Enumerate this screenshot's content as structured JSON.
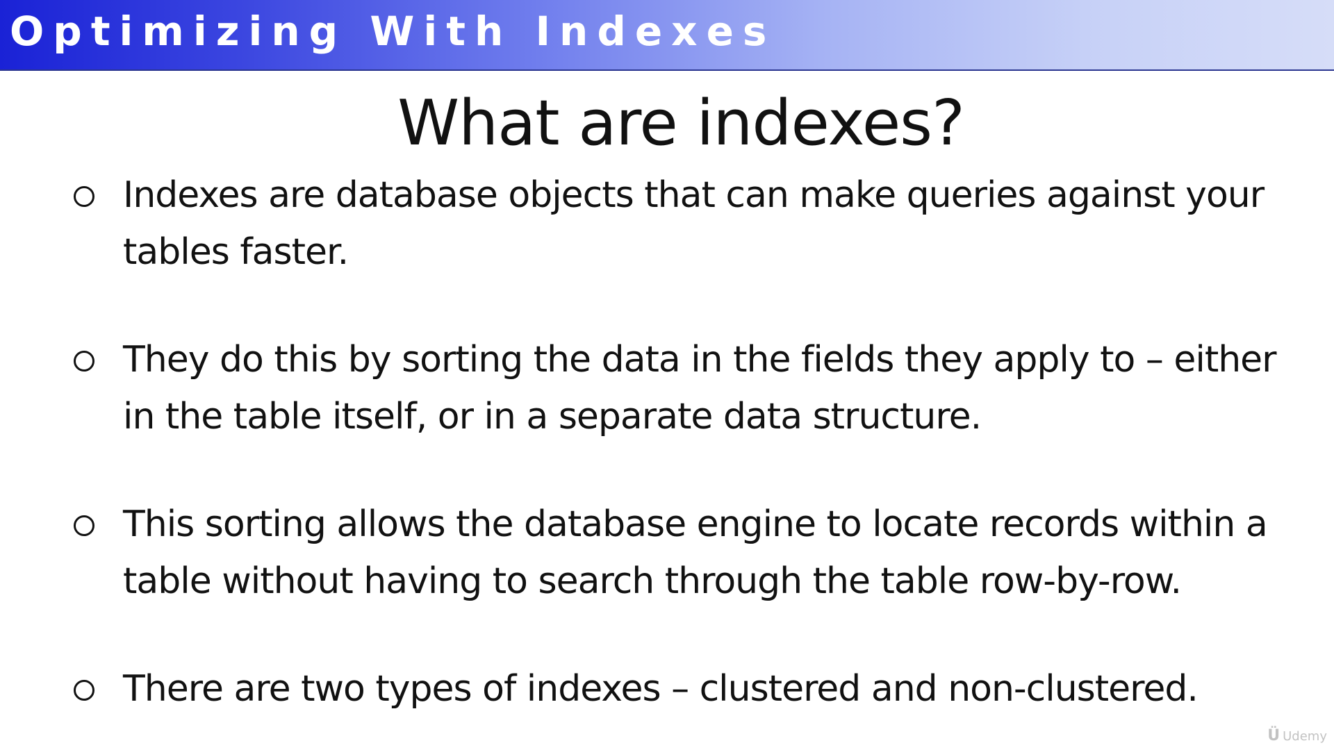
{
  "header": {
    "title": "Optimizing With Indexes"
  },
  "slide": {
    "title": "What are indexes?",
    "bullets": [
      {
        "text": "Indexes are database objects that can make queries against your tables faster."
      },
      {
        "text": "They do this by sorting the data in the fields they apply to – either in the table itself, or in a separate data structure."
      },
      {
        "text": "This sorting allows the database engine to locate records within a table without having to search through the table row-by-row."
      },
      {
        "text": "There are two types of indexes – clustered and non-clustered."
      }
    ]
  },
  "watermark": {
    "icon": "udemy-logo-icon",
    "text": "Udemy"
  }
}
